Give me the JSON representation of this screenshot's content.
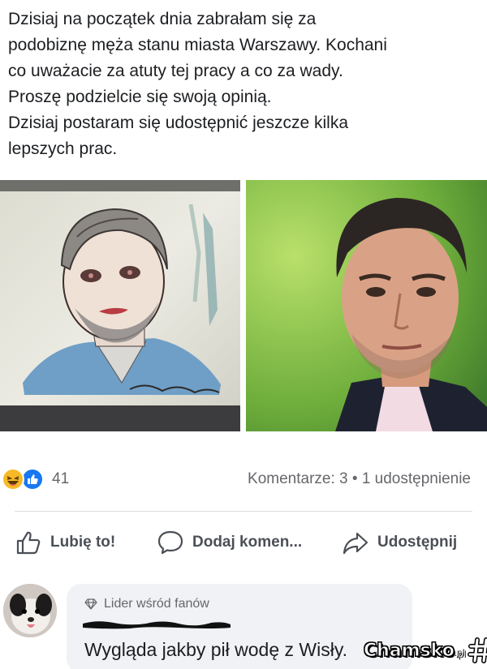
{
  "post": {
    "lines": [
      "Dzisiaj na początek dnia zabrałam się za",
      "podobiznę męża stanu miasta Warszawy. Kochani",
      "co uważacie za atuty tej pracy a co za wady.",
      "Proszę podzielcie się swoją opinią.",
      "Dzisiaj postaram się udostępnić jeszcze kilka",
      "lepszych prac."
    ]
  },
  "reactions": {
    "icons": [
      "haha-reaction-icon",
      "like-reaction-icon"
    ],
    "count": "41"
  },
  "stats": {
    "text": "Komentarze: 3 • 1 udostępnienie"
  },
  "actions": {
    "like": "Lubię to!",
    "comment": "Dodaj komen...",
    "share": "Udostępnij"
  },
  "comment": {
    "badge": "Lider wśród fanów",
    "text": "Wygląda jakby pił wodę z Wisły."
  },
  "watermark": {
    "text": "Chamsko",
    "suffix": ".pl"
  },
  "colors": {
    "text": "#1c1e21",
    "secondary": "#65676b",
    "like_blue": "#1877f2",
    "haha_yellow": "#f7b928",
    "bubble": "#f0f2f5"
  }
}
